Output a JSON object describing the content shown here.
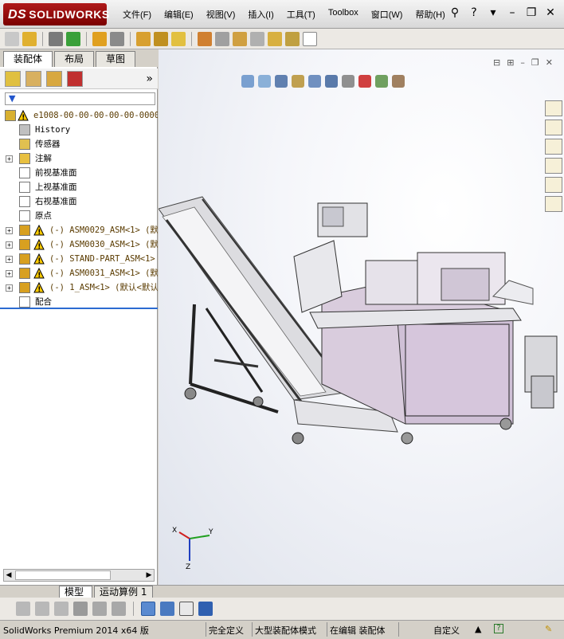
{
  "app": {
    "logo_text": "SOLIDWORKS"
  },
  "menu": [
    "文件(F)",
    "编辑(E)",
    "视图(V)",
    "插入(I)",
    "工具(T)",
    "Toolbox",
    "窗口(W)",
    "帮助(H)"
  ],
  "panel_tabs": [
    "装配体",
    "布局",
    "草图"
  ],
  "filter": {
    "glyph": "▼"
  },
  "tree": [
    {
      "label": "e1008-00-00-00-00-00-0000_",
      "icon": "assembly-icon",
      "warn": true
    },
    {
      "label": "History",
      "icon": "history-icon"
    },
    {
      "label": "传感器",
      "icon": "sensor-icon"
    },
    {
      "label": "注解",
      "icon": "annotation-icon",
      "expandable": true
    },
    {
      "label": "前视基准面",
      "icon": "plane-icon"
    },
    {
      "label": "上视基准面",
      "icon": "plane-icon"
    },
    {
      "label": "右视基准面",
      "icon": "plane-icon"
    },
    {
      "label": "原点",
      "icon": "origin-icon"
    },
    {
      "label": "(-) ASM0029_ASM<1> (默认",
      "icon": "subassembly-icon",
      "warn": true,
      "expandable": true
    },
    {
      "label": "(-) ASM0030_ASM<1> (默认",
      "icon": "subassembly-icon",
      "warn": true,
      "expandable": true
    },
    {
      "label": "(-) STAND-PART_ASM<1>",
      "icon": "subassembly-icon",
      "warn": true,
      "expandable": true
    },
    {
      "label": "(-) ASM0031_ASM<1> (默认",
      "icon": "subassembly-icon",
      "warn": true,
      "expandable": true
    },
    {
      "label": "(-) 1_ASM<1> (默认<默认",
      "icon": "subassembly-icon",
      "warn": true,
      "expandable": true
    },
    {
      "label": "配合",
      "icon": "mates-icon"
    }
  ],
  "triad": {
    "x": "X",
    "y": "Y",
    "z": "Z"
  },
  "bottom_tabs": [
    "模型",
    "运动算例 1"
  ],
  "status": {
    "product": "SolidWorks Premium 2014 x64 版",
    "definition": "完全定义",
    "mode": "大型装配体模式",
    "editing": "在编辑 装配体",
    "custom": "自定义",
    "help": "?"
  },
  "colors": {
    "tree_text": "#5a3b00",
    "warn": "#ffcc00",
    "accent": "#2b6bd1"
  }
}
